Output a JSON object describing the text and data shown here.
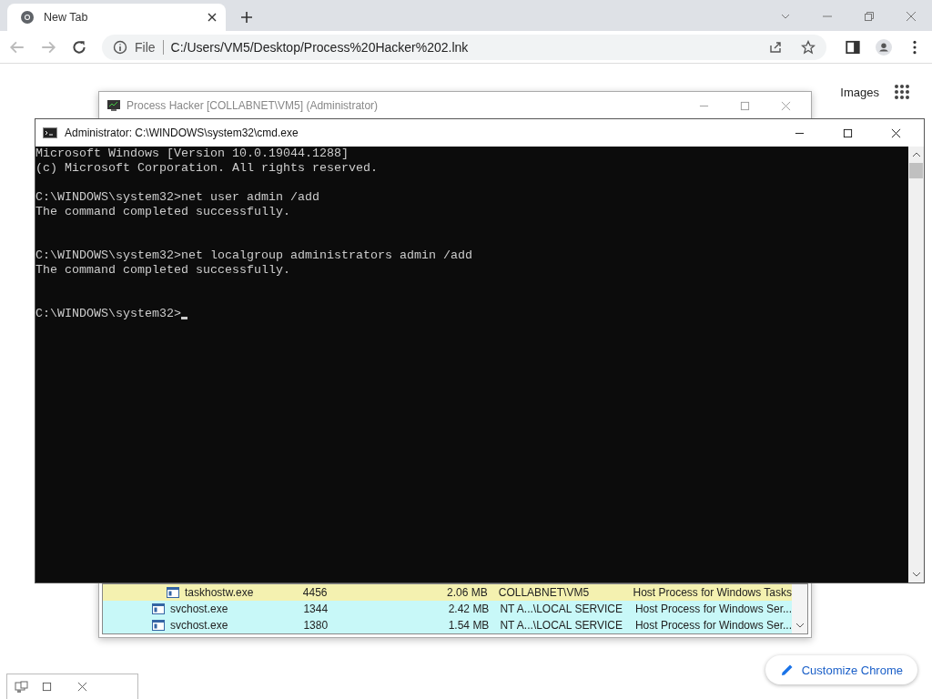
{
  "browser": {
    "tab": {
      "title": "New Tab",
      "selected": true
    },
    "address": {
      "scheme": "File",
      "url": "C:/Users/VM5/Desktop/Process%20Hacker%202.lnk"
    },
    "page_links": [
      "Images"
    ],
    "customize_button": "Customize Chrome"
  },
  "process_hacker": {
    "title": "Process Hacker [COLLABNET\\VM5] (Administrator)",
    "rows": [
      {
        "name": "taskhostw.exe",
        "pid": "4456",
        "memory": "2.06 MB",
        "user": "COLLABNET\\VM5",
        "description": "Host Process for Windows Tasks",
        "color": "#f4f1b0",
        "child": true
      },
      {
        "name": "svchost.exe",
        "pid": "1344",
        "memory": "2.42 MB",
        "user": "NT A...\\LOCAL SERVICE",
        "description": "Host Process for Windows Ser...",
        "color": "#c8f8f8",
        "child": false
      },
      {
        "name": "svchost.exe",
        "pid": "1380",
        "memory": "1.54 MB",
        "user": "NT A...\\LOCAL SERVICE",
        "description": "Host Process for Windows Ser...",
        "color": "#c8f8f8",
        "child": false
      }
    ]
  },
  "cmd": {
    "title": "Administrator: C:\\WINDOWS\\system32\\cmd.exe",
    "lines": [
      {
        "kind": "text",
        "text": "Microsoft Windows [Version 10.0.19044.1288]"
      },
      {
        "kind": "text",
        "text": "(c) Microsoft Corporation. All rights reserved."
      },
      {
        "kind": "blank"
      },
      {
        "kind": "text",
        "text": "C:\\WINDOWS\\system32>net user admin /add"
      },
      {
        "kind": "text",
        "text": "The command completed successfully."
      },
      {
        "kind": "blank"
      },
      {
        "kind": "blank"
      },
      {
        "kind": "text",
        "text": "C:\\WINDOWS\\system32>net localgroup administrators admin /add"
      },
      {
        "kind": "text",
        "text": "The command completed successfully."
      },
      {
        "kind": "blank"
      },
      {
        "kind": "blank"
      },
      {
        "kind": "prompt",
        "text": "C:\\WINDOWS\\system32>",
        "cursor": true
      }
    ]
  }
}
